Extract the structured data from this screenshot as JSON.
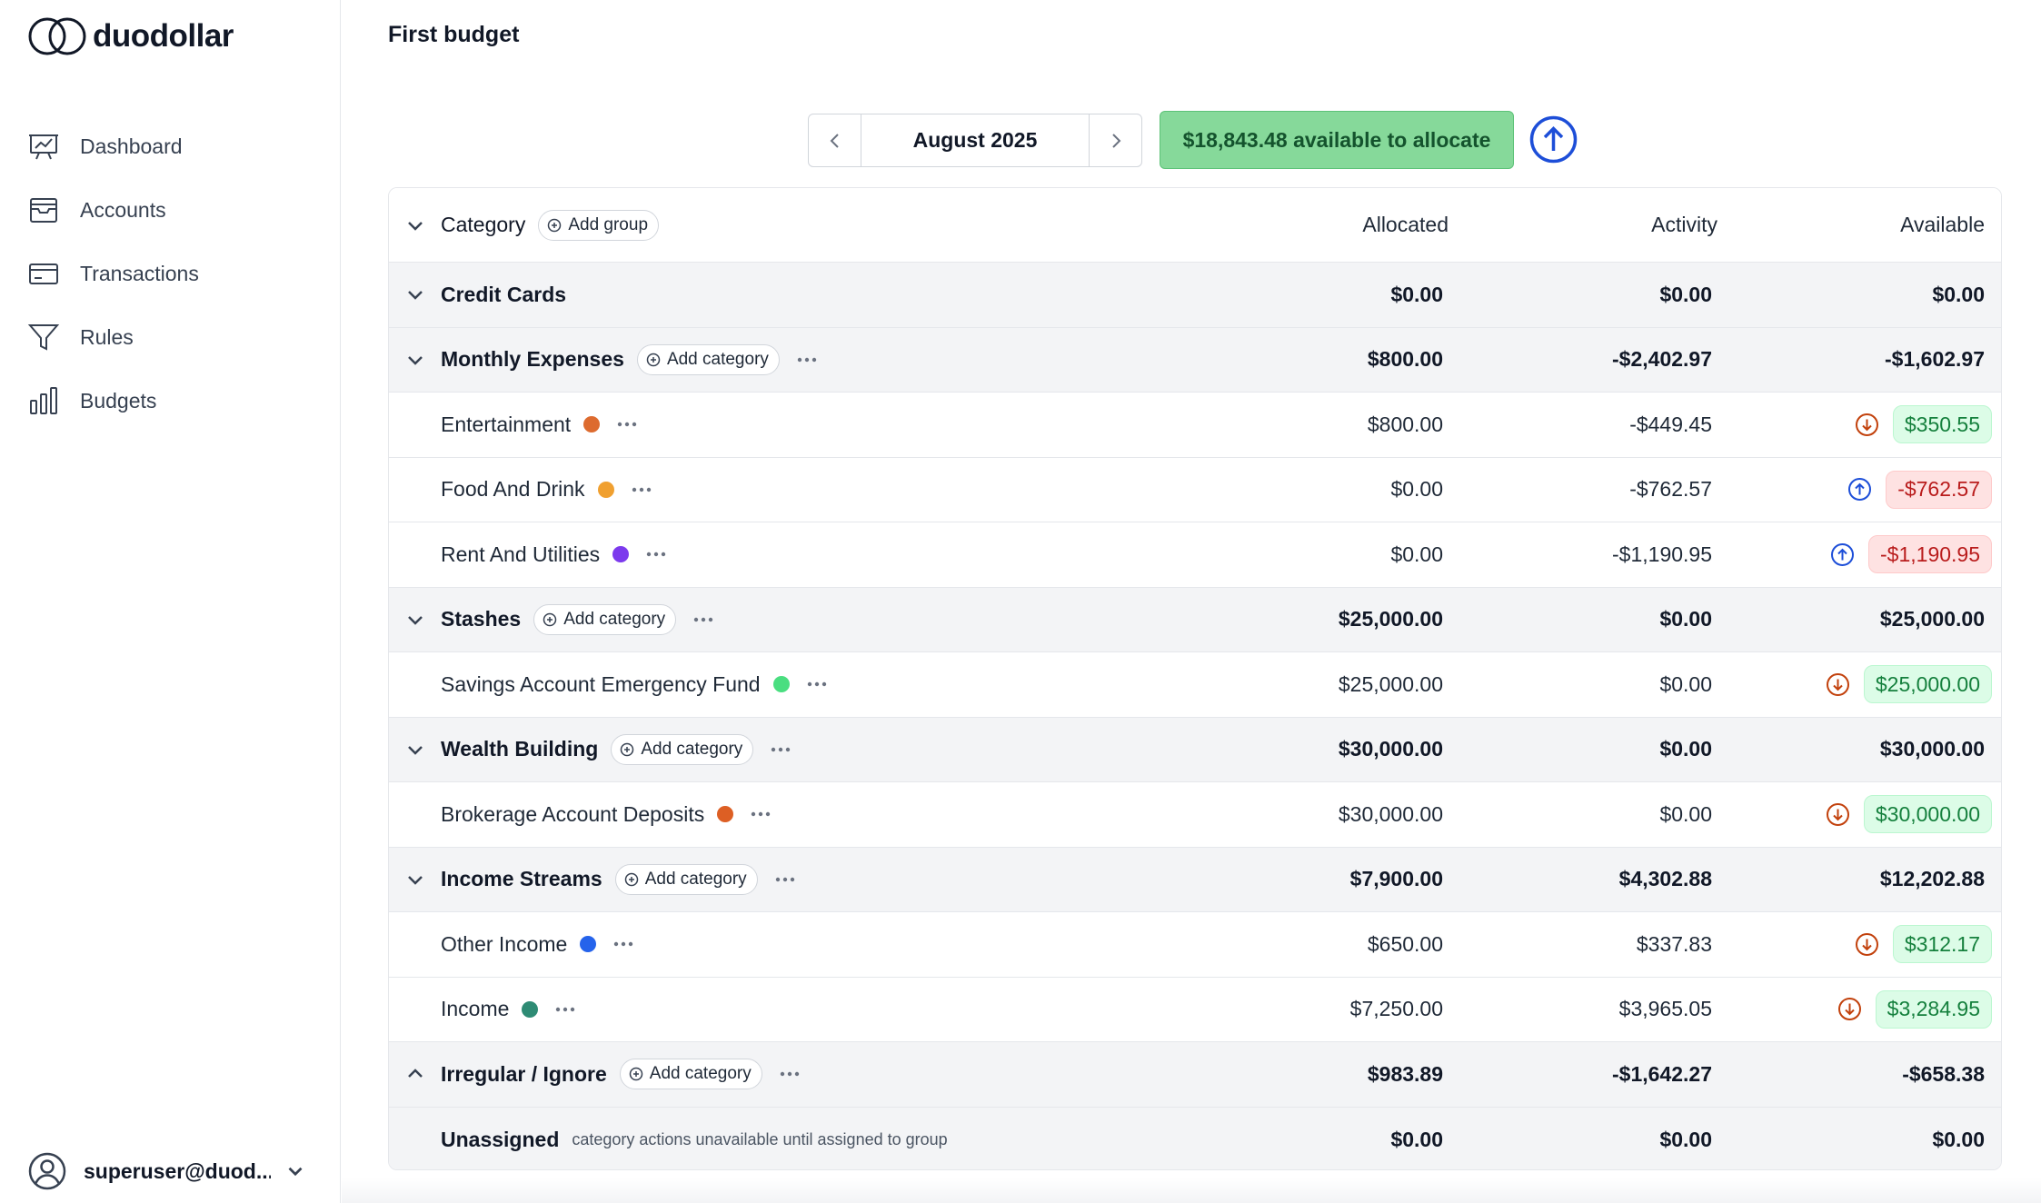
{
  "app": {
    "name": "duodollar"
  },
  "sidebar": {
    "items": [
      {
        "label": "Dashboard",
        "icon": "dashboard-icon"
      },
      {
        "label": "Accounts",
        "icon": "accounts-icon"
      },
      {
        "label": "Transactions",
        "icon": "transactions-icon"
      },
      {
        "label": "Rules",
        "icon": "rules-icon"
      },
      {
        "label": "Budgets",
        "icon": "budgets-icon"
      }
    ],
    "user": {
      "email": "superuser@duod..."
    }
  },
  "page": {
    "title": "First budget"
  },
  "month_nav": {
    "month": "August 2025"
  },
  "allocate_button": {
    "label": "$18,843.48 available to allocate"
  },
  "table": {
    "headers": {
      "category": "Category",
      "add_group": "Add group",
      "allocated": "Allocated",
      "activity": "Activity",
      "available": "Available"
    },
    "add_category_label": "Add category",
    "rows": [
      {
        "type": "group",
        "name": "Credit Cards",
        "allocated": "$0.00",
        "activity": "$0.00",
        "available": "$0.00"
      },
      {
        "type": "group",
        "name": "Monthly Expenses",
        "allocated": "$800.00",
        "activity": "-$2,402.97",
        "available": "-$1,602.97"
      },
      {
        "type": "category",
        "name": "Entertainment",
        "color": "#dd6b2f",
        "allocated": "$800.00",
        "activity": "-$449.45",
        "available": "$350.55",
        "status": "positive",
        "action": "down"
      },
      {
        "type": "category",
        "name": "Food And Drink",
        "color": "#f0a030",
        "allocated": "$0.00",
        "activity": "-$762.57",
        "available": "-$762.57",
        "status": "negative",
        "action": "up"
      },
      {
        "type": "category",
        "name": "Rent And Utilities",
        "color": "#7c3aed",
        "allocated": "$0.00",
        "activity": "-$1,190.95",
        "available": "-$1,190.95",
        "status": "negative",
        "action": "up"
      },
      {
        "type": "group",
        "name": "Stashes",
        "allocated": "$25,000.00",
        "activity": "$0.00",
        "available": "$25,000.00"
      },
      {
        "type": "category",
        "name": "Savings Account Emergency Fund",
        "color": "#4ade80",
        "allocated": "$25,000.00",
        "activity": "$0.00",
        "available": "$25,000.00",
        "status": "positive",
        "action": "down"
      },
      {
        "type": "group",
        "name": "Wealth Building",
        "allocated": "$30,000.00",
        "activity": "$0.00",
        "available": "$30,000.00"
      },
      {
        "type": "category",
        "name": "Brokerage Account Deposits",
        "color": "#dd5f24",
        "allocated": "$30,000.00",
        "activity": "$0.00",
        "available": "$30,000.00",
        "status": "positive",
        "action": "down"
      },
      {
        "type": "group",
        "name": "Income Streams",
        "allocated": "$7,900.00",
        "activity": "$4,302.88",
        "available": "$12,202.88"
      },
      {
        "type": "category",
        "name": "Other Income",
        "color": "#2563eb",
        "allocated": "$650.00",
        "activity": "$337.83",
        "available": "$312.17",
        "status": "positive",
        "action": "down"
      },
      {
        "type": "category",
        "name": "Income",
        "color": "#2e8b74",
        "allocated": "$7,250.00",
        "activity": "$3,965.05",
        "available": "$3,284.95",
        "status": "positive",
        "action": "down"
      },
      {
        "type": "group",
        "name": "Irregular / Ignore",
        "allocated": "$983.89",
        "activity": "-$1,642.27",
        "available": "-$658.38",
        "collapsed": true
      },
      {
        "type": "unassigned",
        "name": "Unassigned",
        "note": "category actions unavailable until assigned to group",
        "allocated": "$0.00",
        "activity": "$0.00",
        "available": "$0.00"
      }
    ]
  },
  "colors": {
    "accent": "#1d4ed8",
    "allocate_bg": "#86d99a",
    "positive": "#15803d",
    "negative": "#b91c1c",
    "down_action": "#c2410c"
  }
}
